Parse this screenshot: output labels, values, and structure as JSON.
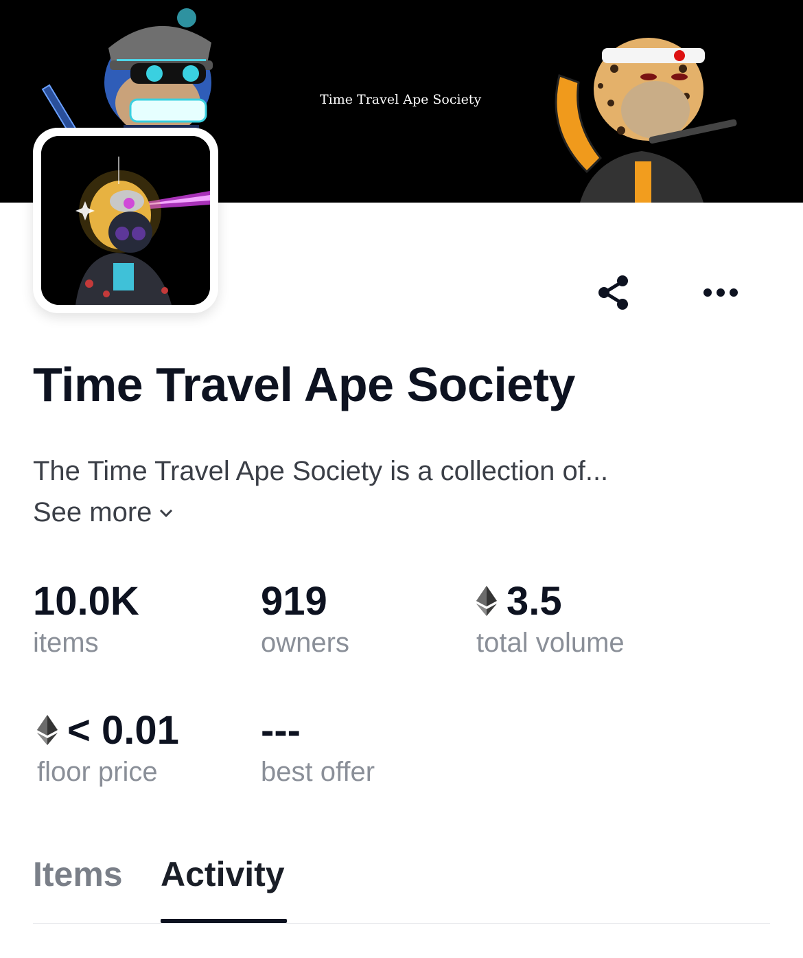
{
  "banner": {
    "text": "Time Travel Ape Society"
  },
  "header": {
    "share_icon": "share-icon",
    "more_icon": "more-horizontal-icon"
  },
  "collection": {
    "title": "Time Travel Ape Society",
    "description": "The Time Travel Ape Society is a collection of...",
    "see_more": "See more"
  },
  "stats": {
    "items": {
      "value": "10.0K",
      "label": "items"
    },
    "owners": {
      "value": "919",
      "label": "owners"
    },
    "total_volume": {
      "value": "3.5",
      "label": "total volume",
      "icon": "ethereum-icon"
    },
    "floor_price": {
      "value": "< 0.01",
      "label": "floor price",
      "icon": "ethereum-icon"
    },
    "best_offer": {
      "value": "---",
      "label": "best offer"
    }
  },
  "tabs": [
    {
      "label": "Items",
      "active": false
    },
    {
      "label": "Activity",
      "active": true
    }
  ],
  "colors": {
    "text_primary": "#0d1220",
    "text_secondary": "#8a8f98",
    "banner_bg": "#000000"
  }
}
